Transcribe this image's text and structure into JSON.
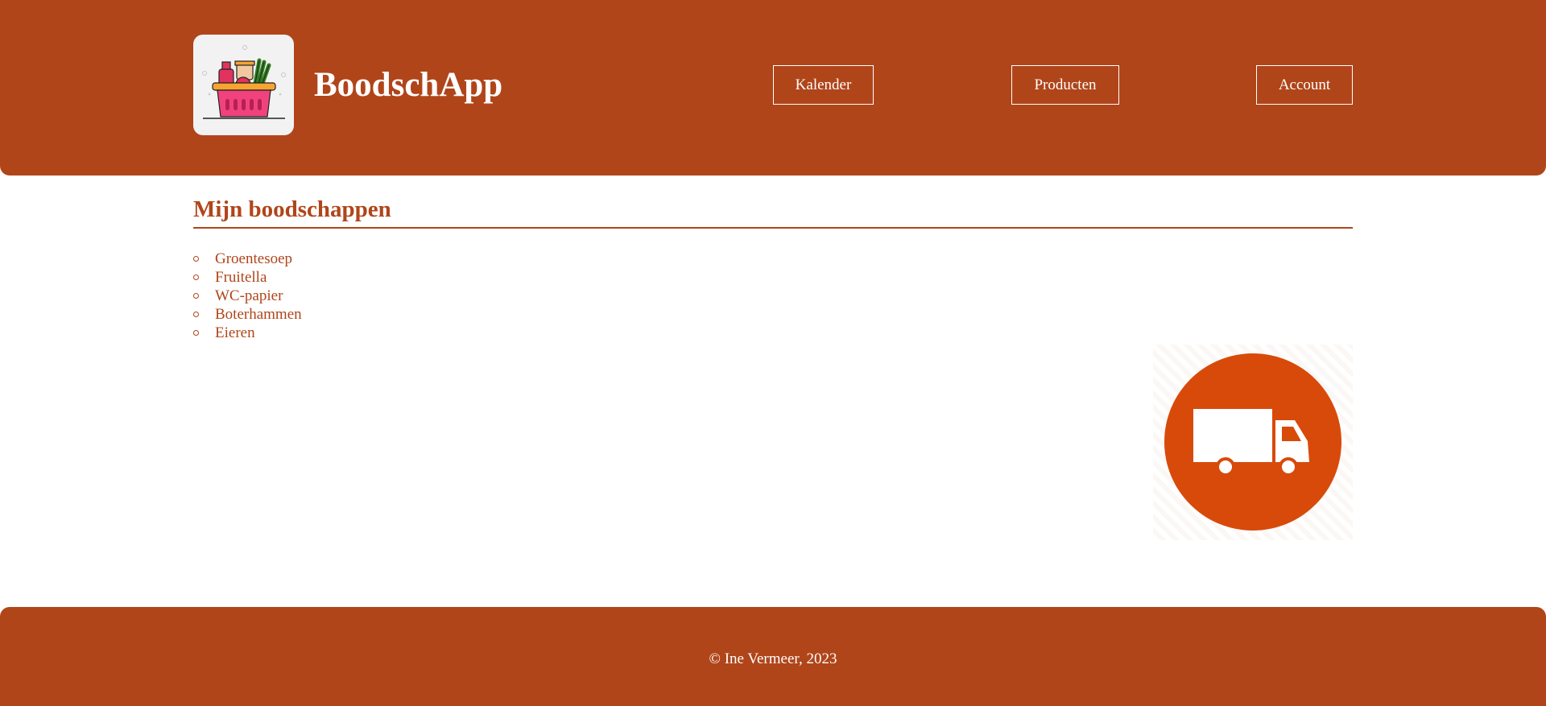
{
  "header": {
    "brand": "BoodschApp",
    "nav": {
      "kalender": "Kalender",
      "producten": "Producten",
      "account": "Account"
    }
  },
  "main": {
    "title": "Mijn boodschappen",
    "items": [
      "Groentesoep",
      "Fruitella",
      "WC-papier",
      "Boterhammen",
      "Eieren"
    ]
  },
  "footer": {
    "copyright": "© Ine Vermeer, 2023"
  },
  "colors": {
    "primary": "#b0451a",
    "truck_circle": "#d84a0a",
    "background": "#ffffff"
  },
  "icons": {
    "logo": "shopping-basket-icon",
    "delivery": "truck-icon"
  }
}
